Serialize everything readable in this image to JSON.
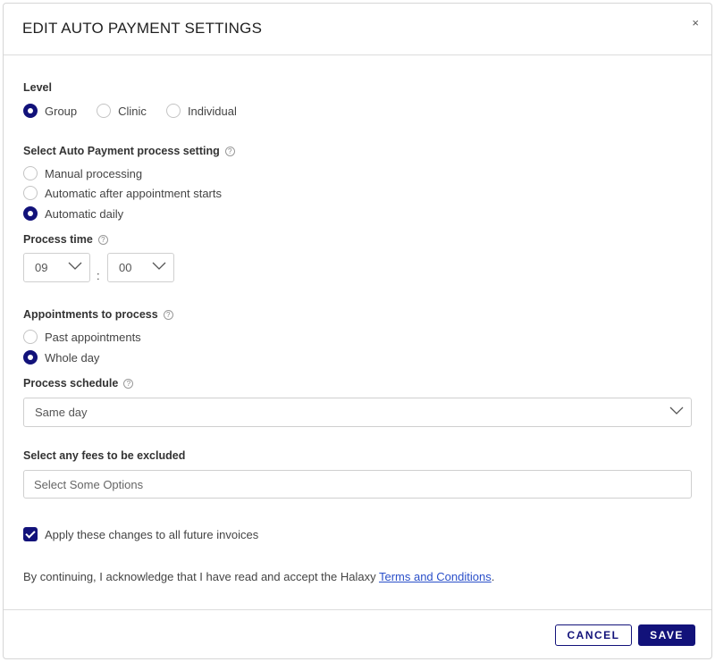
{
  "modal": {
    "title": "EDIT AUTO PAYMENT SETTINGS",
    "close_label": "×"
  },
  "level": {
    "label": "Level",
    "options": [
      "Group",
      "Clinic",
      "Individual"
    ],
    "selected": "Group"
  },
  "process_setting": {
    "label": "Select Auto Payment process setting",
    "options": [
      "Manual processing",
      "Automatic after appointment starts",
      "Automatic daily"
    ],
    "selected": "Automatic daily"
  },
  "process_time": {
    "label": "Process time",
    "hour": "09",
    "separator": ":",
    "minute": "00"
  },
  "appointments": {
    "label": "Appointments to process",
    "options": [
      "Past appointments",
      "Whole day"
    ],
    "selected": "Whole day"
  },
  "schedule": {
    "label": "Process schedule",
    "value": "Same day"
  },
  "fees": {
    "label": "Select any fees to be excluded",
    "placeholder": "Select Some Options"
  },
  "apply_checkbox": {
    "label": "Apply these changes to all future invoices",
    "checked": true
  },
  "acknowledge": {
    "text": "By continuing, I acknowledge that I have read and accept the Halaxy ",
    "link_text": "Terms and Conditions",
    "suffix": "."
  },
  "footer": {
    "cancel_label": "CANCEL",
    "save_label": "SAVE"
  },
  "help_icon_glyph": "?",
  "colors": {
    "accent": "#12127a",
    "link": "#2a4fc9"
  }
}
